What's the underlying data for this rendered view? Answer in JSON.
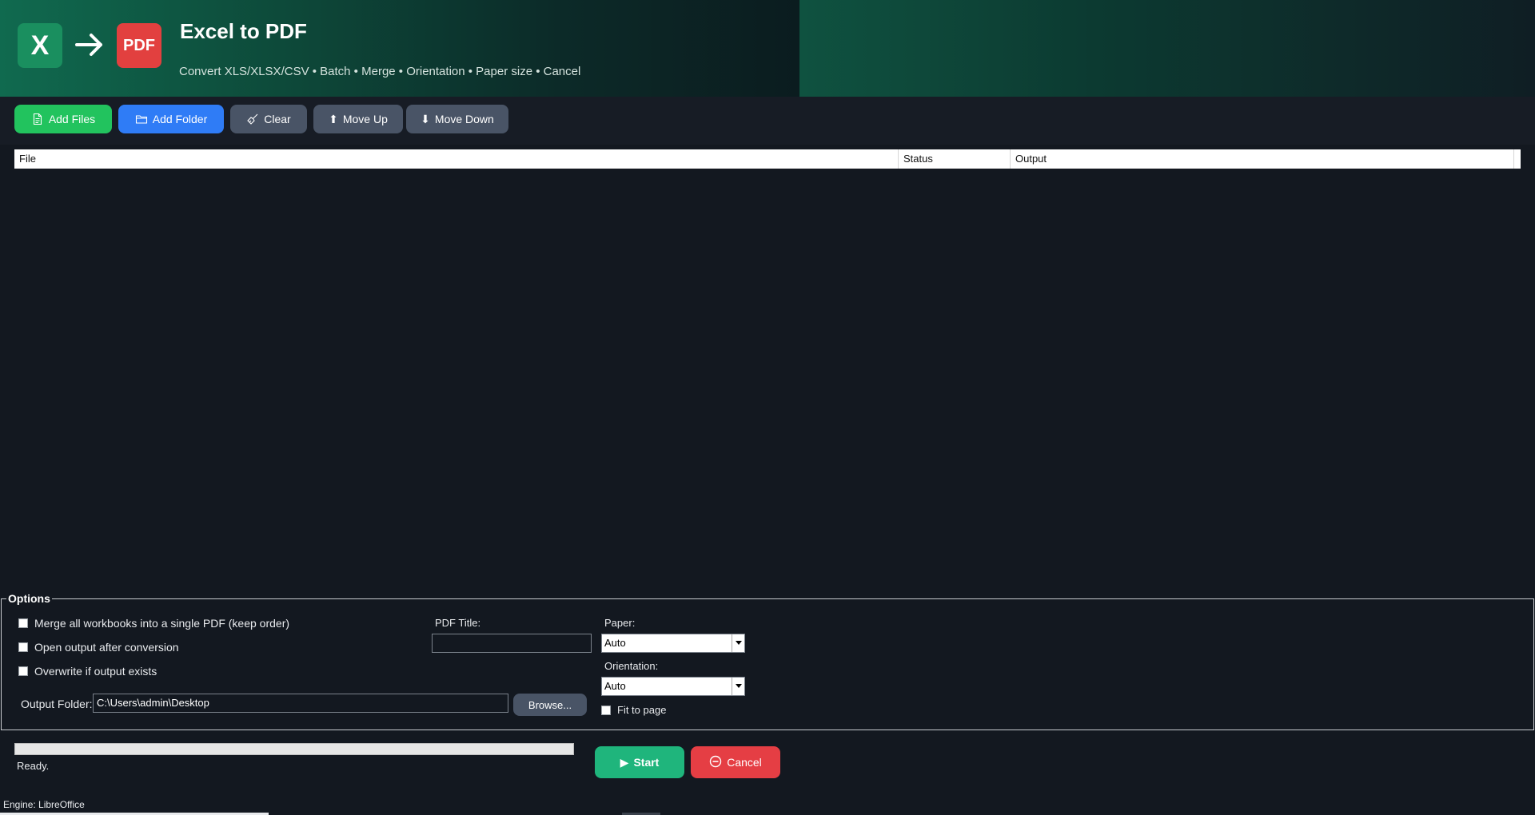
{
  "header": {
    "logo_left": "X",
    "logo_right": "PDF",
    "title": "Excel to PDF",
    "subtitle": "Convert XLS/XLSX/CSV • Batch • Merge • Orientation • Paper size • Cancel"
  },
  "toolbar": {
    "add_files": "Add Files",
    "add_folder": "Add Folder",
    "clear": "Clear",
    "move_up": "Move Up",
    "move_down": "Move Down"
  },
  "table": {
    "columns": [
      "File",
      "Status",
      "Output"
    ],
    "rows": []
  },
  "options": {
    "legend": "Options",
    "merge_label": "Merge all workbooks into a single PDF (keep order)",
    "merge_checked": false,
    "open_output_label": "Open output after conversion",
    "open_output_checked": false,
    "overwrite_label": "Overwrite if output exists",
    "overwrite_checked": false,
    "output_folder_label": "Output Folder:",
    "output_folder_value": "C:\\Users\\admin\\Desktop",
    "browse_label": "Browse...",
    "pdf_title_label": "PDF Title:",
    "pdf_title_value": "",
    "paper_label": "Paper:",
    "paper_value": "Auto",
    "orientation_label": "Orientation:",
    "orientation_value": "Auto",
    "fit_label": "Fit to page",
    "fit_checked": false
  },
  "bottom": {
    "progress_percent": 0,
    "status": "Ready.",
    "start_label": "Start",
    "cancel_label": "Cancel",
    "engine": "Engine: LibreOffice"
  },
  "colors": {
    "accent_green": "#22c35e",
    "accent_blue": "#2f7cf6",
    "start_green": "#1fb57c",
    "cancel_red": "#e53e44",
    "excel_green": "#1a8f5f",
    "pdf_red": "#e2403f"
  }
}
